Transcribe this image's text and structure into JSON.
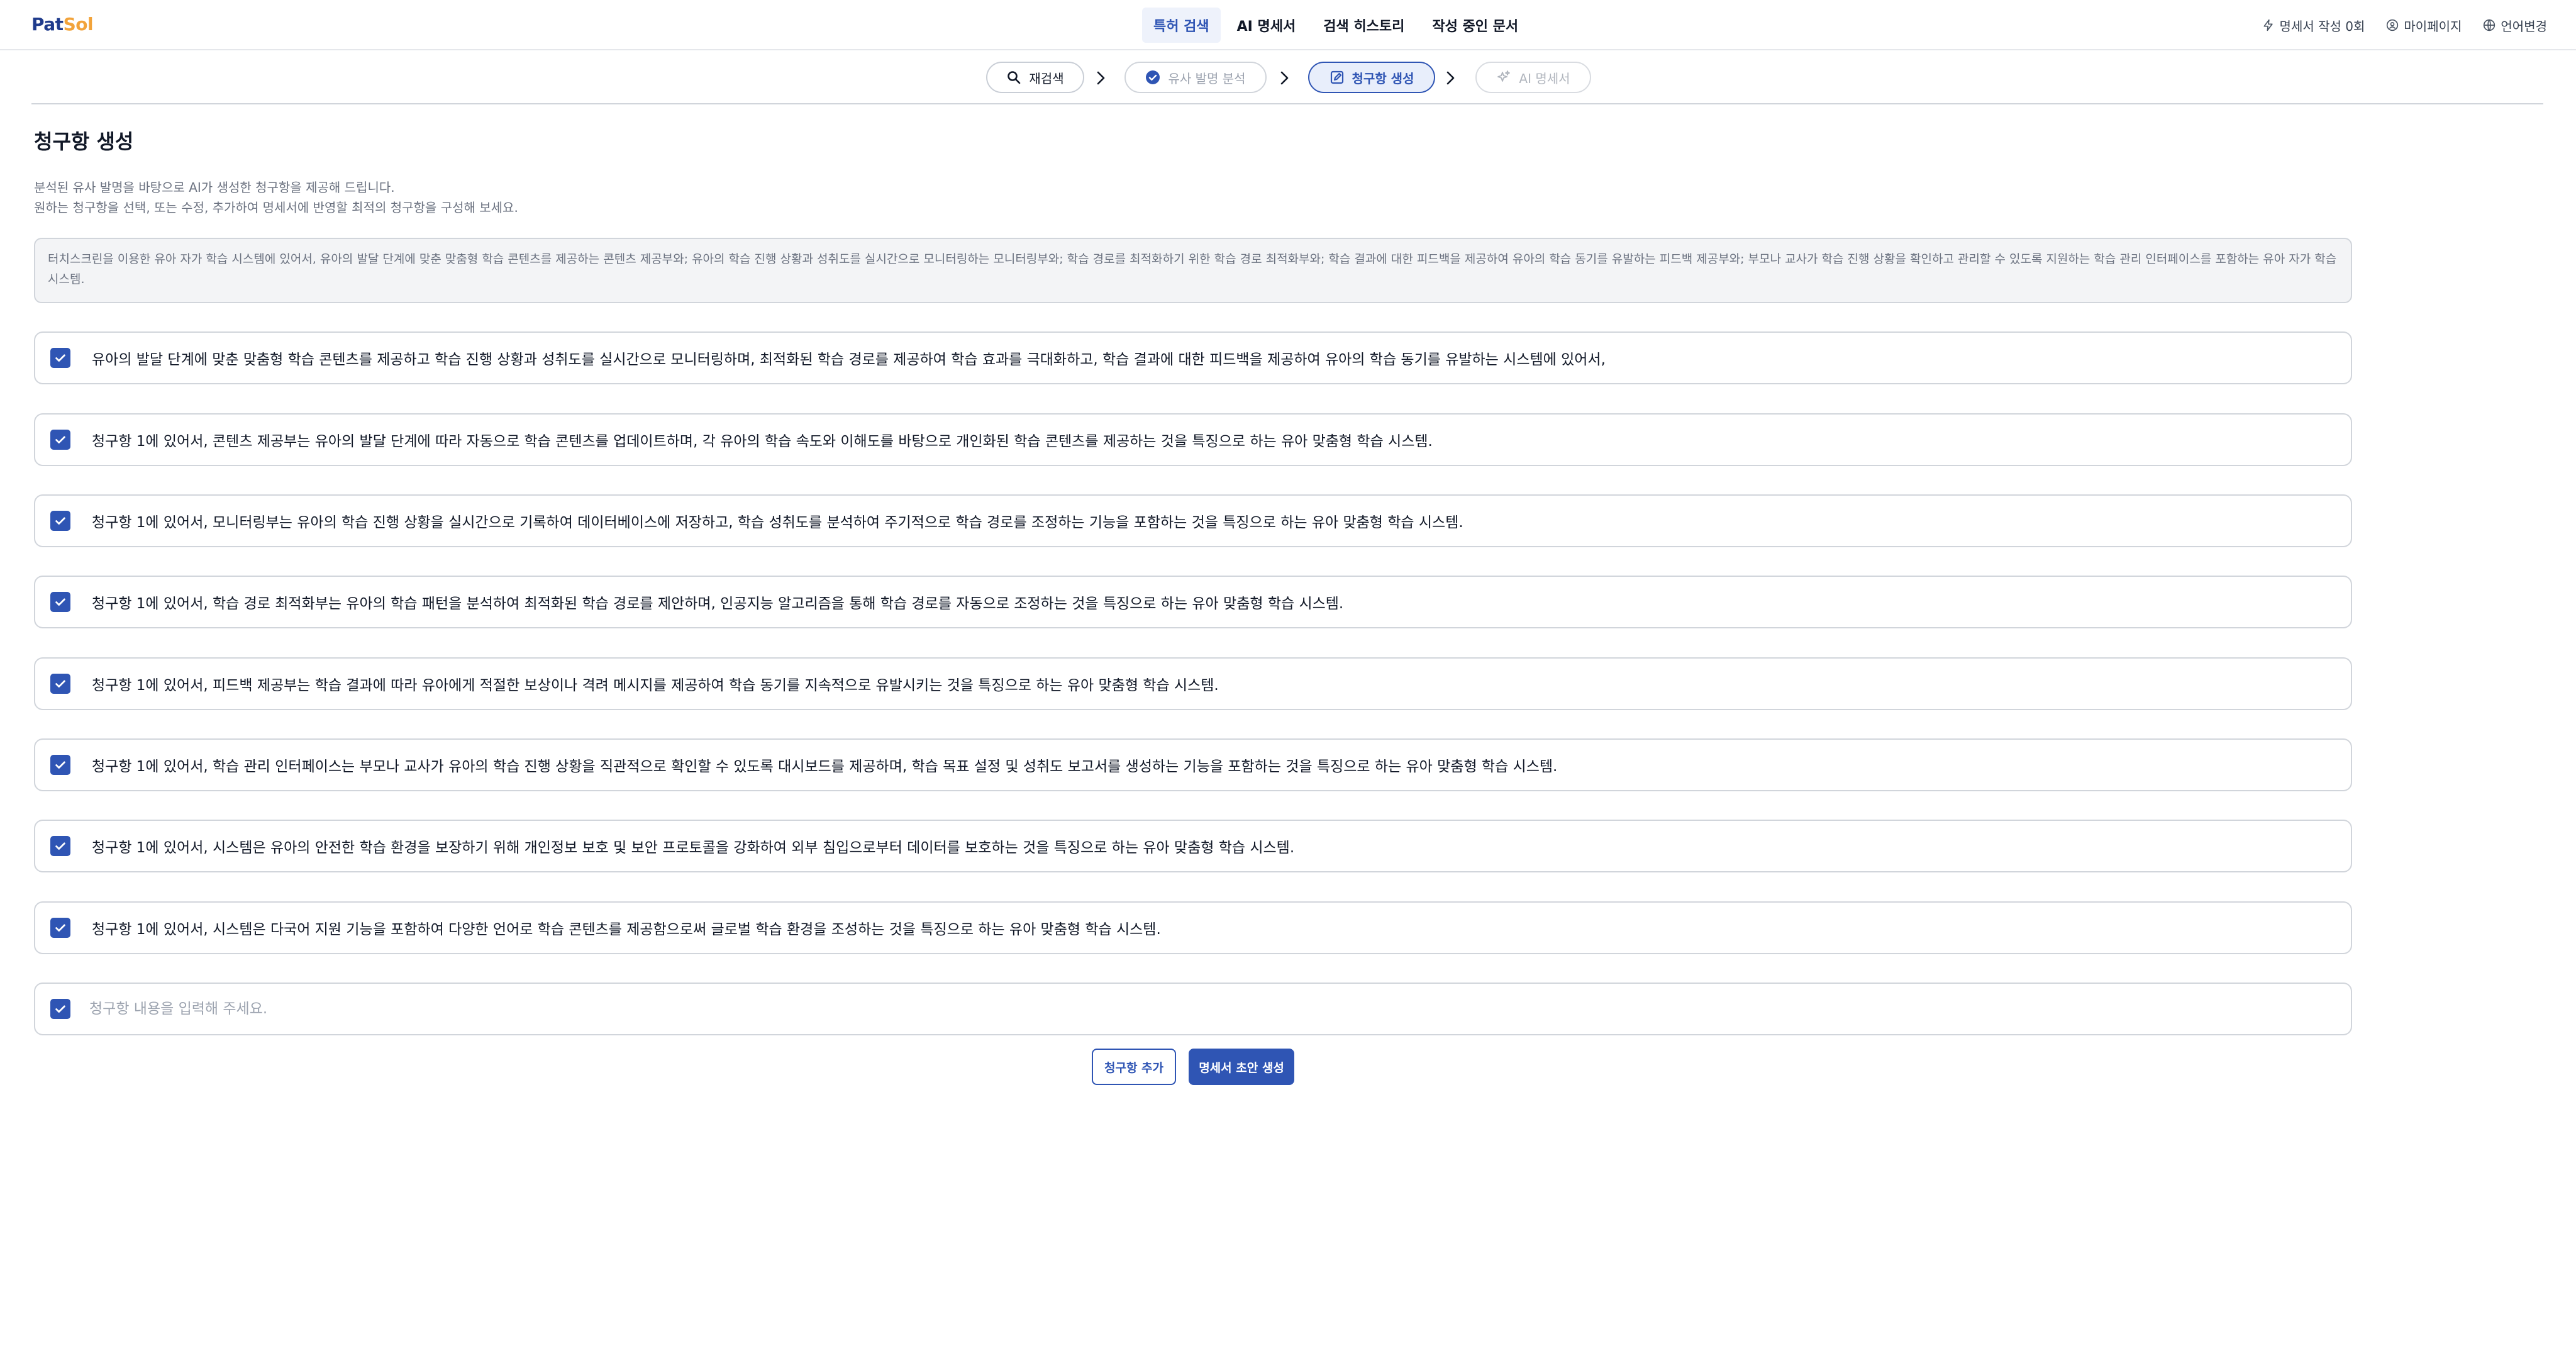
{
  "header": {
    "logo_part1": "Pat",
    "logo_part2": "Sol",
    "nav": [
      "특허 검색",
      "AI 명세서",
      "검색 히스토리",
      "작성 중인 문서"
    ],
    "active_nav": 0,
    "right_menu": {
      "credits": "명세서 작성 0회",
      "mypage": "마이페이지",
      "language": "언어변경"
    }
  },
  "stepper": {
    "steps": [
      {
        "label": "재검색",
        "icon": "search-icon",
        "state": "default"
      },
      {
        "label": "유사 발명 분석",
        "icon": "check-circle-icon",
        "state": "done"
      },
      {
        "label": "청구항 생성",
        "icon": "edit-icon",
        "state": "current"
      },
      {
        "label": "AI 명세서",
        "icon": "sparkle-icon",
        "state": "future"
      }
    ]
  },
  "page": {
    "title": "청구항 생성",
    "description_line1": "분석된 유사 발명을 바탕으로 AI가 생성한 청구항을 제공해 드립니다.",
    "description_line2": "원하는 청구항을 선택, 또는 수정, 추가하여 명세서에 반영할 최적의 청구항을 구성해 보세요.",
    "summary": "터치스크린을 이용한 유아 자가 학습 시스템에 있어서, 유아의 발달 단계에 맞춘 맞춤형 학습 콘텐츠를 제공하는 콘텐츠 제공부와; 유아의 학습 진행 상황과 성취도를 실시간으로 모니터링하는 모니터링부와; 학습 경로를 최적화하기 위한 학습 경로 최적화부와; 학습 결과에 대한 피드백을 제공하여 유아의 학습 동기를 유발하는 피드백 제공부와; 부모나 교사가 학습 진행 상황을 확인하고 관리할 수 있도록 지원하는 학습 관리 인터페이스를 포함하는 유아 자가 학습 시스템."
  },
  "claims": [
    {
      "checked": true,
      "text": "유아의 발달 단계에 맞춘 맞춤형 학습 콘텐츠를 제공하고 학습 진행 상황과 성취도를 실시간으로 모니터링하며, 최적화된 학습 경로를 제공하여 학습 효과를 극대화하고, 학습 결과에 대한 피드백을 제공하여 유아의 학습 동기를 유발하는 시스템에 있어서,"
    },
    {
      "checked": true,
      "text": "청구항 1에 있어서, 콘텐츠 제공부는 유아의 발달 단계에 따라 자동으로 학습 콘텐츠를 업데이트하며, 각 유아의 학습 속도와 이해도를 바탕으로 개인화된 학습 콘텐츠를 제공하는 것을 특징으로 하는 유아 맞춤형 학습 시스템."
    },
    {
      "checked": true,
      "text": "청구항 1에 있어서, 모니터링부는 유아의 학습 진행 상황을 실시간으로 기록하여 데이터베이스에 저장하고, 학습 성취도를 분석하여 주기적으로 학습 경로를 조정하는 기능을 포함하는 것을 특징으로 하는 유아 맞춤형 학습 시스템."
    },
    {
      "checked": true,
      "text": "청구항 1에 있어서, 학습 경로 최적화부는 유아의 학습 패턴을 분석하여 최적화된 학습 경로를 제안하며, 인공지능 알고리즘을 통해 학습 경로를 자동으로 조정하는 것을 특징으로 하는 유아 맞춤형 학습 시스템."
    },
    {
      "checked": true,
      "text": "청구항 1에 있어서, 피드백 제공부는 학습 결과에 따라 유아에게 적절한 보상이나 격려 메시지를 제공하여 학습 동기를 지속적으로 유발시키는 것을 특징으로 하는 유아 맞춤형 학습 시스템."
    },
    {
      "checked": true,
      "text": "청구항 1에 있어서, 학습 관리 인터페이스는 부모나 교사가 유아의 학습 진행 상황을 직관적으로 확인할 수 있도록 대시보드를 제공하며, 학습 목표 설정 및 성취도 보고서를 생성하는 기능을 포함하는 것을 특징으로 하는 유아 맞춤형 학습 시스템."
    },
    {
      "checked": true,
      "text": "청구항 1에 있어서, 시스템은 유아의 안전한 학습 환경을 보장하기 위해 개인정보 보호 및 보안 프로토콜을 강화하여 외부 침입으로부터 데이터를 보호하는 것을 특징으로 하는 유아 맞춤형 학습 시스템."
    },
    {
      "checked": true,
      "text": "청구항 1에 있어서, 시스템은 다국어 지원 기능을 포함하여 다양한 언어로 학습 콘텐츠를 제공함으로써 글로벌 학습 환경을 조성하는 것을 특징으로 하는 유아 맞춤형 학습 시스템."
    }
  ],
  "new_claim": {
    "checked": true,
    "value": "",
    "placeholder": "청구항 내용을 입력해 주세요."
  },
  "buttons": {
    "add_claim": "청구항 추가",
    "generate": "명세서 초안 생성"
  },
  "colors": {
    "primary": "#2f55b4",
    "logo_dark": "#1f3b8c",
    "logo_accent": "#f2a33a",
    "border": "#d1d5db",
    "summary_bg": "#f3f4f6"
  }
}
